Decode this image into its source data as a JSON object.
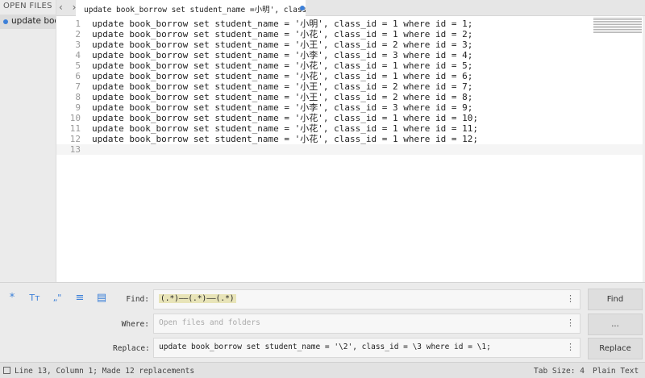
{
  "sidebar": {
    "header": "OPEN FILES",
    "file": "update book"
  },
  "tabbar": {
    "nav": "‹ ›",
    "tab_title": "update book_borrow set student_name =小明', class_"
  },
  "editor": {
    "line_numbers": [
      "1",
      "2",
      "3",
      "4",
      "5",
      "6",
      "7",
      "8",
      "9",
      "10",
      "11",
      "12",
      "13"
    ],
    "lines": [
      "update book_borrow set student_name = '小明', class_id = 1 where id = 1;",
      "update book_borrow set student_name = '小花', class_id = 1 where id = 2;",
      "update book_borrow set student_name = '小王', class_id = 2 where id = 3;",
      "update book_borrow set student_name = '小李', class_id = 3 where id = 4;",
      "update book_borrow set student_name = '小花', class_id = 1 where id = 5;",
      "update book_borrow set student_name = '小花', class_id = 1 where id = 6;",
      "update book_borrow set student_name = '小王', class_id = 2 where id = 7;",
      "update book_borrow set student_name = '小王', class_id = 2 where id = 8;",
      "update book_borrow set student_name = '小李', class_id = 3 where id = 9;",
      "update book_borrow set student_name = '小花', class_id = 1 where id = 10;",
      "update book_borrow set student_name = '小花', class_id = 1 where id = 11;",
      "update book_borrow set student_name = '小花', class_id = 1 where id = 12;",
      ""
    ]
  },
  "find": {
    "options": [
      "*",
      "Tт",
      "„\"",
      "≡",
      "▤"
    ],
    "find_label": "Find:",
    "find_value": "(.*)——(.*)——(.*)",
    "where_label": "Where:",
    "where_placeholder": "Open files and folders",
    "replace_label": "Replace:",
    "replace_value": "update book_borrow set student_name = '\\2', class_id = \\3 where id = \\1;",
    "menu_glyph": "⋮",
    "find_button": "Find",
    "where_button": "...",
    "replace_button": "Replace"
  },
  "status": {
    "text": "Line 13, Column 1; Made 12 replacements",
    "tab_size": "Tab Size: 4",
    "syntax": "Plain Text"
  }
}
